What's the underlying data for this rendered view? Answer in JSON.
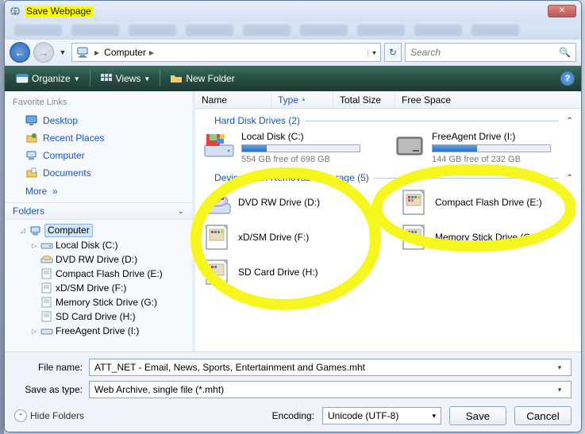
{
  "title": "Save Webpage",
  "breadcrumb": {
    "root_icon": "computer",
    "seg1": "Computer"
  },
  "search": {
    "placeholder": "Search"
  },
  "toolbar": {
    "organize": "Organize",
    "views": "Views",
    "new_folder": "New Folder"
  },
  "columns": {
    "name": "Name",
    "type": "Type",
    "total_size": "Total Size",
    "free_space": "Free Space"
  },
  "fav": {
    "header": "Favorite Links",
    "items": [
      {
        "icon": "desktop",
        "label": "Desktop"
      },
      {
        "icon": "recent",
        "label": "Recent Places"
      },
      {
        "icon": "computer",
        "label": "Computer"
      },
      {
        "icon": "documents",
        "label": "Documents"
      }
    ],
    "more": "More",
    "folders_hdr": "Folders"
  },
  "tree": {
    "root": "Computer",
    "children": [
      "Local Disk (C:)",
      "DVD RW Drive (D:)",
      "Compact Flash Drive (E:)",
      "xD/SM Drive (F:)",
      "Memory Stick Drive (G:)",
      "SD Card Drive (H:)",
      "FreeAgent Drive (I:)"
    ]
  },
  "groups": {
    "hdd": {
      "label": "Hard Disk Drives (2)"
    },
    "removable": {
      "label": "Devices with Removable Storage (5)"
    }
  },
  "drives": {
    "c": {
      "name": "Local Disk (C:)",
      "free_text": "554 GB free of 698 GB",
      "fill_pct": 21
    },
    "i": {
      "name": "FreeAgent Drive (I:)",
      "free_text": "144 GB free of 232 GB",
      "fill_pct": 38
    }
  },
  "devices": [
    {
      "name": "DVD RW Drive (D:)",
      "icon": "dvd"
    },
    {
      "name": "Compact Flash Drive (E:)",
      "icon": "card"
    },
    {
      "name": "xD/SM Drive (F:)",
      "icon": "card"
    },
    {
      "name": "Memory Stick Drive (G:)",
      "icon": "card"
    },
    {
      "name": "SD Card Drive (H:)",
      "icon": "card"
    }
  ],
  "filename": {
    "label": "File name:",
    "value": "ATT_NET - Email, News, Sports, Entertainment and Games.mht"
  },
  "saveastype": {
    "label": "Save as type:",
    "value": "Web Archive, single file (*.mht)"
  },
  "hide_folders": "Hide Folders",
  "encoding": {
    "label": "Encoding:",
    "value": "Unicode (UTF-8)"
  },
  "buttons": {
    "save": "Save",
    "cancel": "Cancel"
  }
}
